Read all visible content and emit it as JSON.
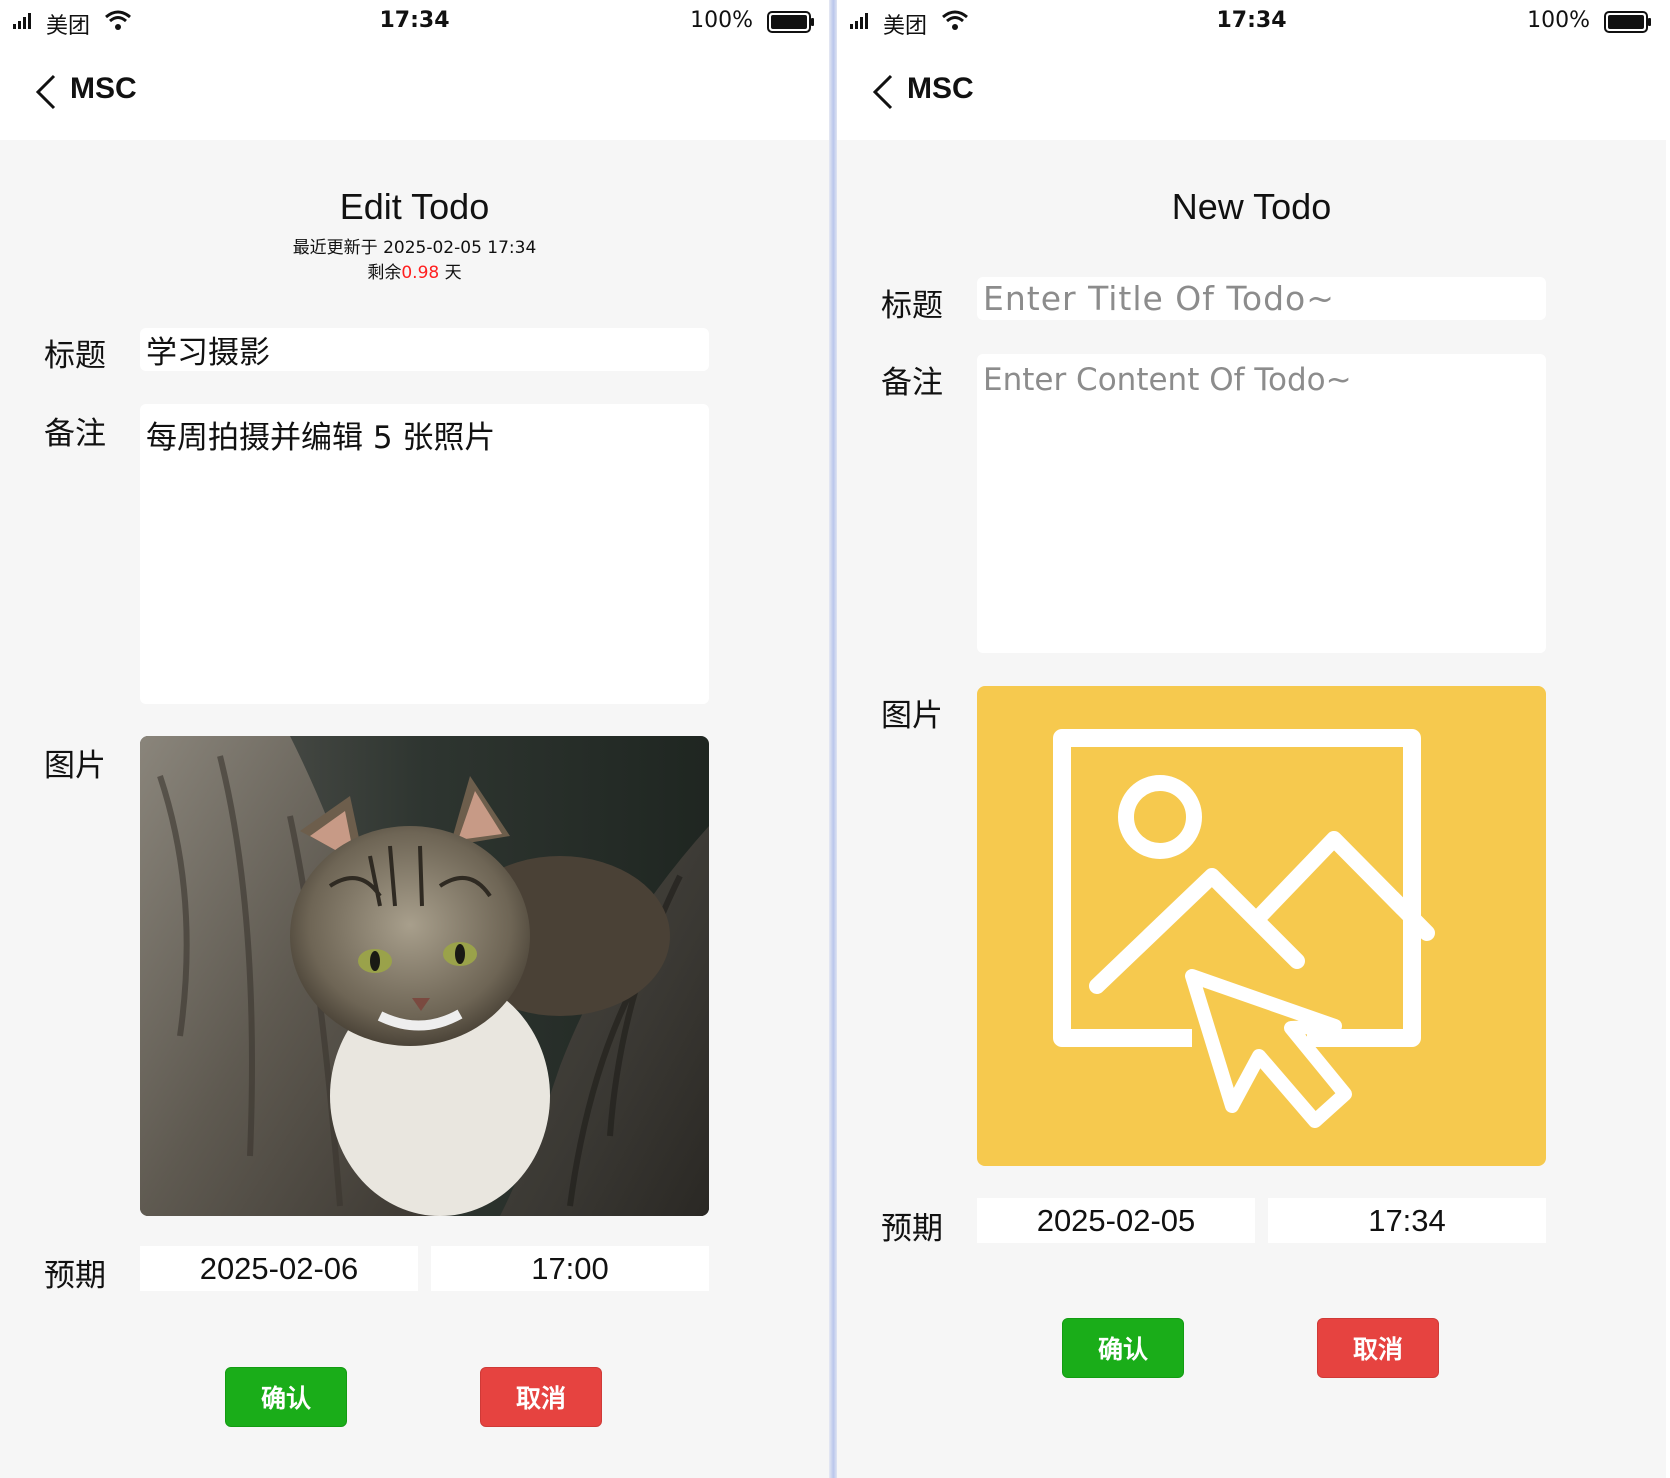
{
  "statusbar": {
    "carrier": "美团",
    "time": "17:34",
    "battery": "100%"
  },
  "navbar": {
    "title": "MSC"
  },
  "edit_todo": {
    "heading": "Edit Todo",
    "updated_prefix": "最近更新于",
    "updated_at": "2025-02-05 17:34",
    "remaining_prefix": "剩余",
    "remaining_value": "0.98",
    "remaining_suffix": "天",
    "title_label": "标题",
    "title_value": "学习摄影",
    "note_label": "备注",
    "note_value": "每周拍摄并编辑 5 张照片",
    "image_label": "图片",
    "image_subject": "cat-on-tree-photo",
    "due_label": "预期",
    "due_date": "2025-02-06",
    "due_time": "17:00",
    "confirm": "确认",
    "cancel": "取消"
  },
  "new_todo": {
    "heading": "New Todo",
    "title_label": "标题",
    "title_placeholder": "Enter Title Of Todo~",
    "note_label": "备注",
    "note_placeholder": "Enter Content Of Todo~",
    "image_label": "图片",
    "image_icon": "image-upload-icon",
    "due_label": "预期",
    "due_date": "2025-02-05",
    "due_time": "17:34",
    "confirm": "确认",
    "cancel": "取消"
  },
  "colors": {
    "confirm": "#1aad19",
    "cancel": "#e64340",
    "remaining_highlight": "#ff1f1f",
    "upload_placeholder": "#f6c94e",
    "page_bg": "#f6f6f6"
  }
}
